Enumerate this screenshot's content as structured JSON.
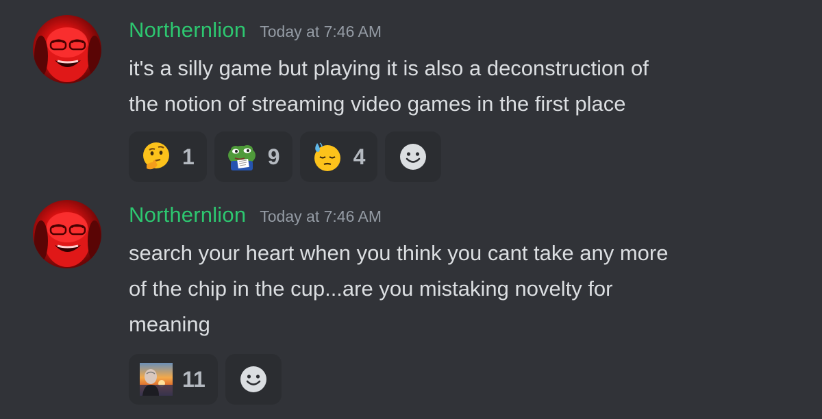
{
  "messages": [
    {
      "username": "Northernlion",
      "timestamp": "Today at 7:46 AM",
      "lines": [
        "it's a silly game but playing it is also a deconstruction of",
        "the notion of streaming video games in the first place"
      ],
      "reactions": [
        {
          "emoji": "thinking-face",
          "count": "1"
        },
        {
          "emoji": "pepe-notes",
          "count": "9"
        },
        {
          "emoji": "sweat-relieved-face",
          "count": "4"
        }
      ]
    },
    {
      "username": "Northernlion",
      "timestamp": "Today at 7:46 AM",
      "lines": [
        "search your heart when you think you cant take any more",
        "of the chip in the cup...are you mistaking novelty for",
        "meaning"
      ],
      "reactions": [
        {
          "emoji": "sunset-portrait",
          "count": "11"
        }
      ]
    }
  ],
  "colors": {
    "background": "#313338",
    "username": "#2dc770",
    "timestamp": "#949ba4",
    "text": "#dbdee1",
    "reaction_bg": "#2b2d31",
    "reaction_count": "#b5bac1"
  }
}
